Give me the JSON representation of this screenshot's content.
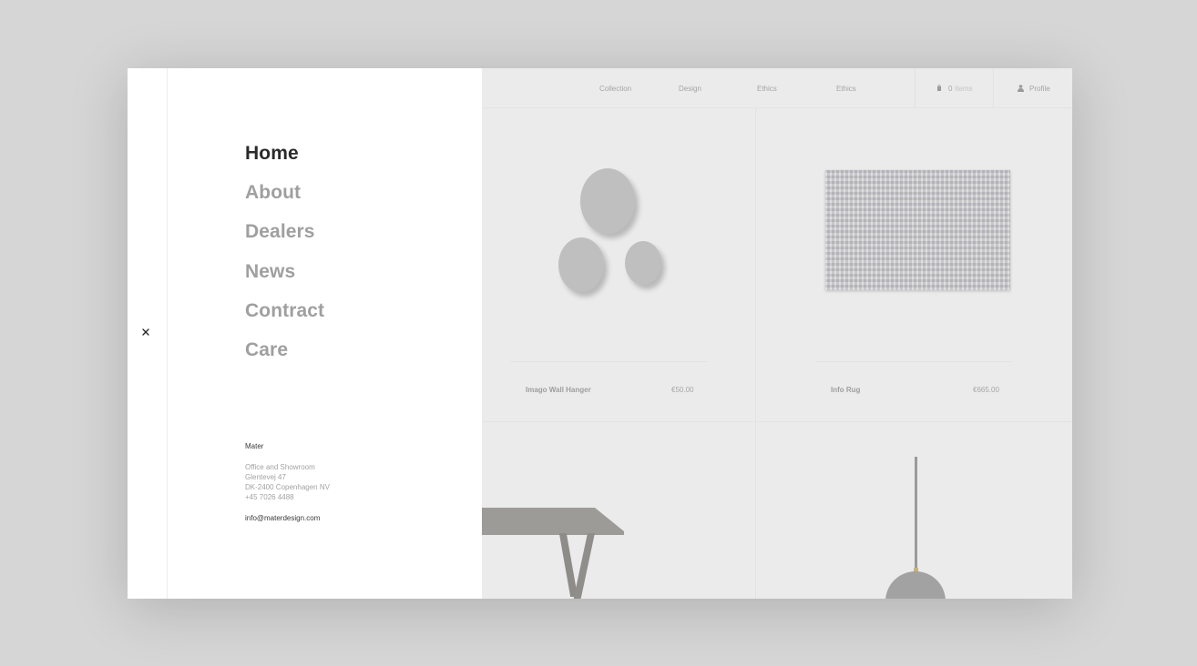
{
  "colors": {
    "backdrop": "#d6d6d6",
    "panel": "#ffffff",
    "active_menu": "#2a2a2a",
    "inactive_menu": "#9f9f9f"
  },
  "topnav": {
    "links": [
      "Collection",
      "Design",
      "Ethics",
      "Ethics"
    ],
    "cart": {
      "icon": "bag-icon",
      "count": "0",
      "label": "Items"
    },
    "profile": {
      "icon": "user-icon",
      "label": "Profile"
    }
  },
  "products": [
    {
      "name": "Imago Wall Hanger",
      "price": "€50.00"
    },
    {
      "name": "Info Rug",
      "price": "€665.00"
    }
  ],
  "menu": {
    "close_icon": "close-icon",
    "items": [
      {
        "label": "Home",
        "active": true
      },
      {
        "label": "About",
        "active": false
      },
      {
        "label": "Dealers",
        "active": false
      },
      {
        "label": "News",
        "active": false
      },
      {
        "label": "Contract",
        "active": false
      },
      {
        "label": "Care",
        "active": false
      }
    ]
  },
  "contact": {
    "brand": "Mater",
    "address": [
      "Office and Showroom",
      "Glentevej 47",
      "DK-2400 Copenhagen NV",
      "+45 7026 4488"
    ],
    "email": "info@materdesign.com"
  }
}
